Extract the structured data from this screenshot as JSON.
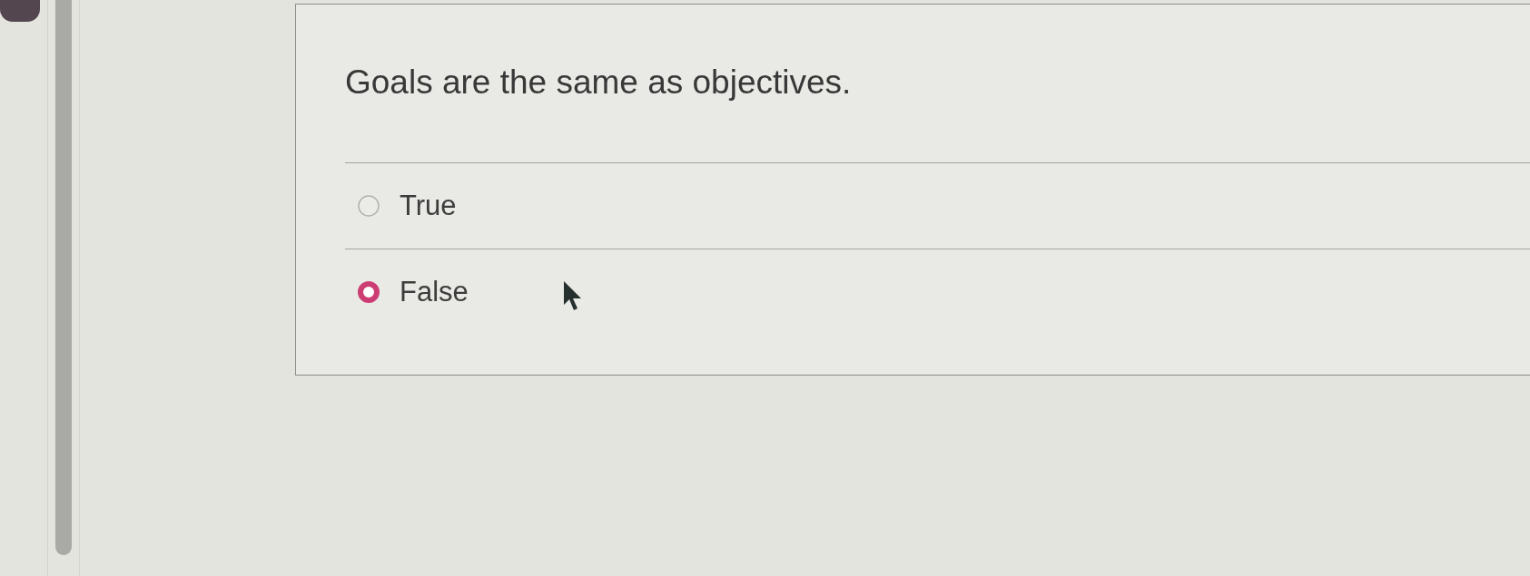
{
  "question": {
    "text": "Goals are the same as objectives."
  },
  "options": [
    {
      "label": "True",
      "selected": false
    },
    {
      "label": "False",
      "selected": true
    }
  ]
}
